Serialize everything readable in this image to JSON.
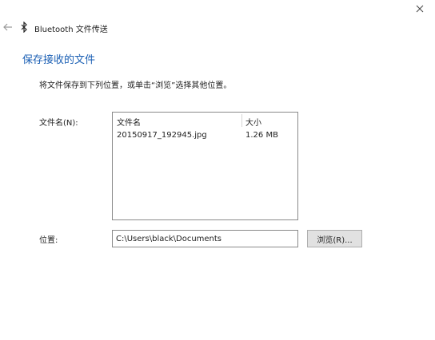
{
  "window": {
    "title": "Bluetooth 文件传送"
  },
  "icons": {
    "back": "back-arrow-icon",
    "bluetooth": "bluetooth-icon",
    "close": "close-icon"
  },
  "page": {
    "title": "保存接收的文件",
    "instructions": "将文件保存到下列位置，或单击“浏览”选择其他位置。"
  },
  "files": {
    "label": "文件名(N):",
    "columns": {
      "name": "文件名",
      "size": "大小"
    },
    "rows": [
      {
        "name": "20150917_192945.jpg",
        "size": "1.26 MB"
      }
    ]
  },
  "location": {
    "label": "位置:",
    "value": "C:\\Users\\black\\Documents",
    "browse_label": "浏览(R)..."
  },
  "colors": {
    "accent": "#1a5fb4"
  }
}
